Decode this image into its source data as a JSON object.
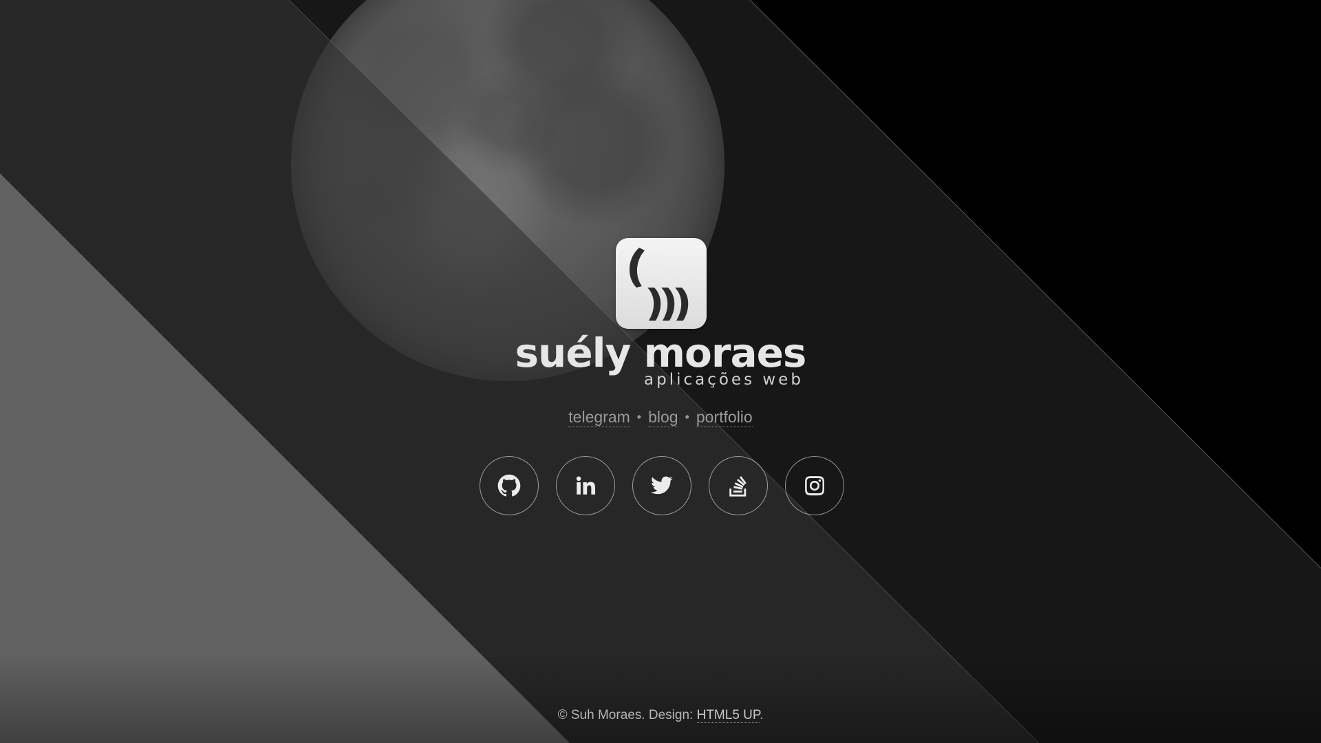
{
  "brand": {
    "name": "suély moraes",
    "tagline": "aplicações web"
  },
  "nav": {
    "items": [
      {
        "label": "telegram"
      },
      {
        "label": "blog"
      },
      {
        "label": "portfolio"
      }
    ],
    "separator": "•"
  },
  "social": {
    "items": [
      {
        "icon": "github-icon"
      },
      {
        "icon": "linkedin-icon"
      },
      {
        "icon": "twitter-icon"
      },
      {
        "icon": "stackoverflow-icon"
      },
      {
        "icon": "instagram-icon"
      }
    ]
  },
  "footer": {
    "copyright": "© Suh Moraes. Design: ",
    "design_link": "HTML5 UP",
    "suffix": "."
  },
  "colors": {
    "background": "#000000",
    "band_light": "#5e5e5e",
    "band_mid": "#2e2e2e",
    "text": "#e6e6e6",
    "link": "#9a9a9a"
  }
}
